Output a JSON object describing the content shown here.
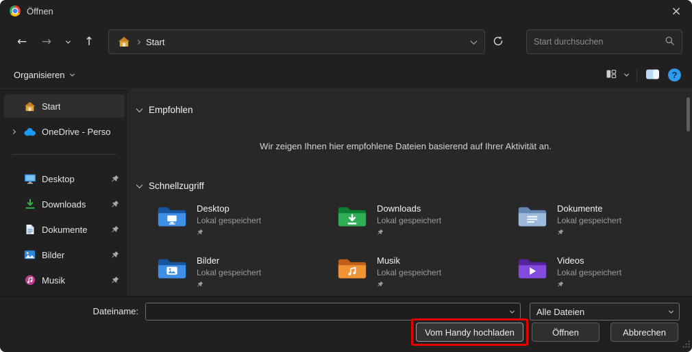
{
  "window": {
    "title": "Öffnen"
  },
  "icons": {
    "back": "←",
    "forward": "→",
    "up": "↑",
    "close": "×",
    "help": "?"
  },
  "nav": {
    "breadcrumb_root": "Start",
    "search_placeholder": "Start durchsuchen"
  },
  "toolbar": {
    "organize_label": "Organisieren"
  },
  "sidebar": {
    "items": [
      {
        "label": "Start",
        "icon": "home-icon",
        "selected": true
      },
      {
        "label": "OneDrive - Perso",
        "icon": "onedrive-cloud-icon"
      },
      {
        "label": "Desktop",
        "icon": "desktop-monitor-icon",
        "pinned": true
      },
      {
        "label": "Downloads",
        "icon": "download-arrow-icon",
        "pinned": true
      },
      {
        "label": "Dokumente",
        "icon": "document-icon",
        "pinned": true
      },
      {
        "label": "Bilder",
        "icon": "picture-icon",
        "pinned": true
      },
      {
        "label": "Musik",
        "icon": "music-note-icon",
        "pinned": true
      }
    ]
  },
  "main": {
    "recommended_title": "Empfohlen",
    "recommended_empty": "Wir zeigen Ihnen hier empfohlene Dateien basierend auf Ihrer Aktivität an.",
    "quickaccess_title": "Schnellzugriff",
    "tiles": [
      {
        "name": "Desktop",
        "status": "Lokal gespeichert",
        "icon": "desktop-folder-icon"
      },
      {
        "name": "Downloads",
        "status": "Lokal gespeichert",
        "icon": "downloads-folder-icon"
      },
      {
        "name": "Dokumente",
        "status": "Lokal gespeichert",
        "icon": "documents-folder-icon"
      },
      {
        "name": "Bilder",
        "status": "Lokal gespeichert",
        "icon": "pictures-folder-icon"
      },
      {
        "name": "Musik",
        "status": "Lokal gespeichert",
        "icon": "music-folder-icon"
      },
      {
        "name": "Videos",
        "status": "Lokal gespeichert",
        "icon": "videos-folder-icon"
      }
    ]
  },
  "footer": {
    "filename_label": "Dateiname:",
    "filename_value": "",
    "filetype_value": "Alle Dateien",
    "upload_button": "Vom Handy hochladen",
    "open_button": "Öffnen",
    "cancel_button": "Abbrechen"
  },
  "colors": {
    "annotation_red": "#e60000",
    "help_blue": "#2e9bf0",
    "window_bg": "#202020",
    "content_bg": "#282828"
  }
}
